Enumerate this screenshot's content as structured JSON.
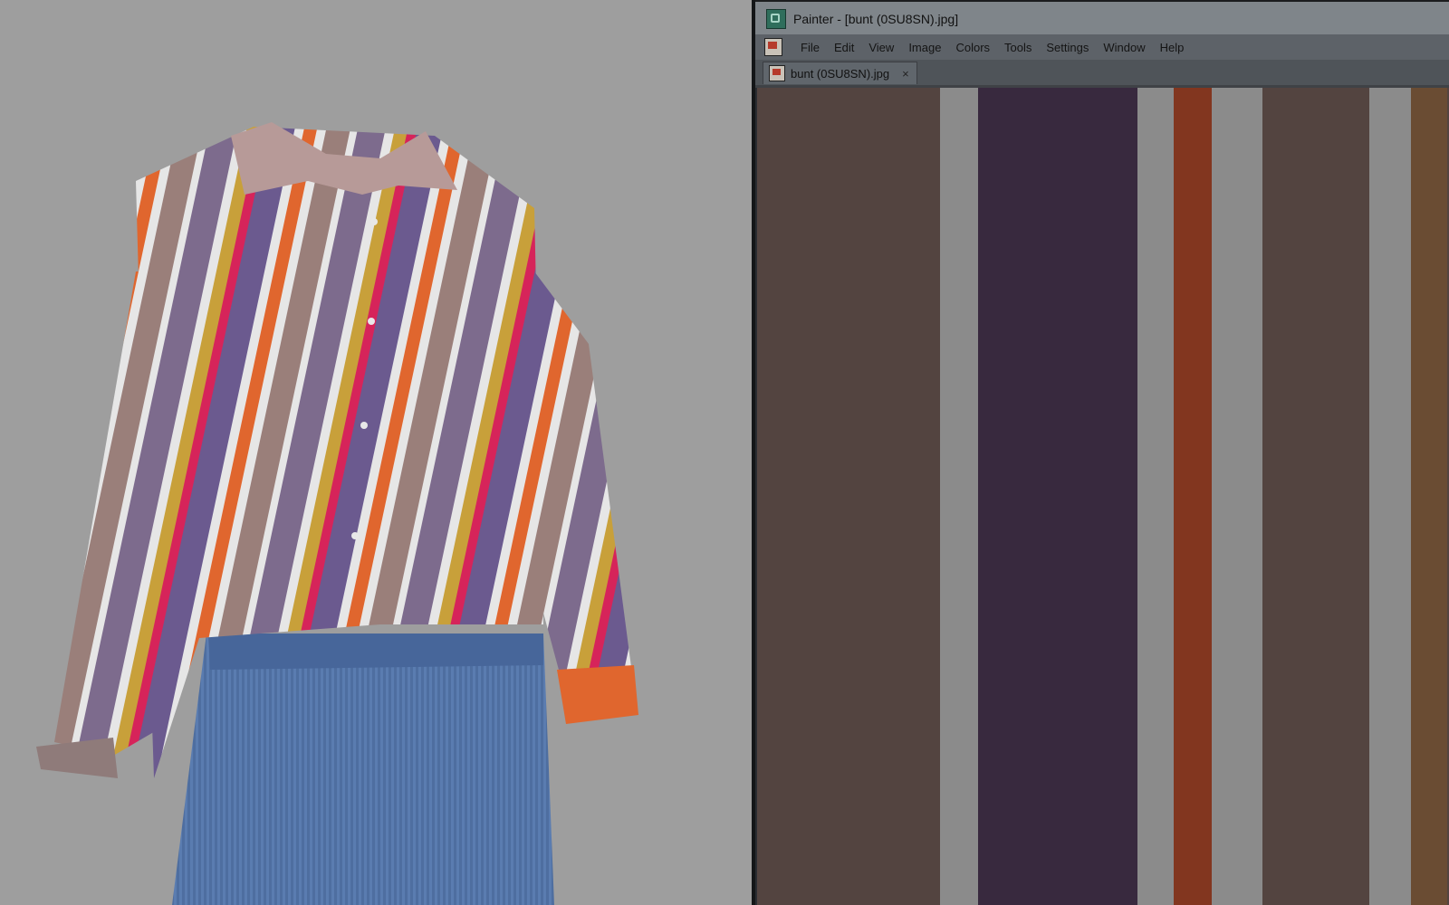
{
  "window": {
    "title": "Painter - [bunt (0SU8SN).jpg]",
    "icon": "painter-app-icon"
  },
  "menu": {
    "items": [
      "File",
      "Edit",
      "View",
      "Image",
      "Colors",
      "Tools",
      "Settings",
      "Window",
      "Help"
    ]
  },
  "tab": {
    "label": "bunt (0SU8SN).jpg",
    "close_glyph": "×"
  },
  "canvas": {
    "stripe_colors": [
      "#534440",
      "#8b8b8b",
      "#38293e",
      "#8b8b8b",
      "#82361f",
      "#8b8b8b",
      "#534440",
      "#8b8b8b",
      "#6a4c33"
    ]
  },
  "viewport": {
    "background": "#9e9e9e",
    "shirt_stripe_colors": [
      "#6b5a8f",
      "#e4e4e4",
      "#e0662e",
      "#9a7f7a",
      "#cfcfd6",
      "#6b5a8f",
      "#c8a03a",
      "#d6245a"
    ]
  }
}
